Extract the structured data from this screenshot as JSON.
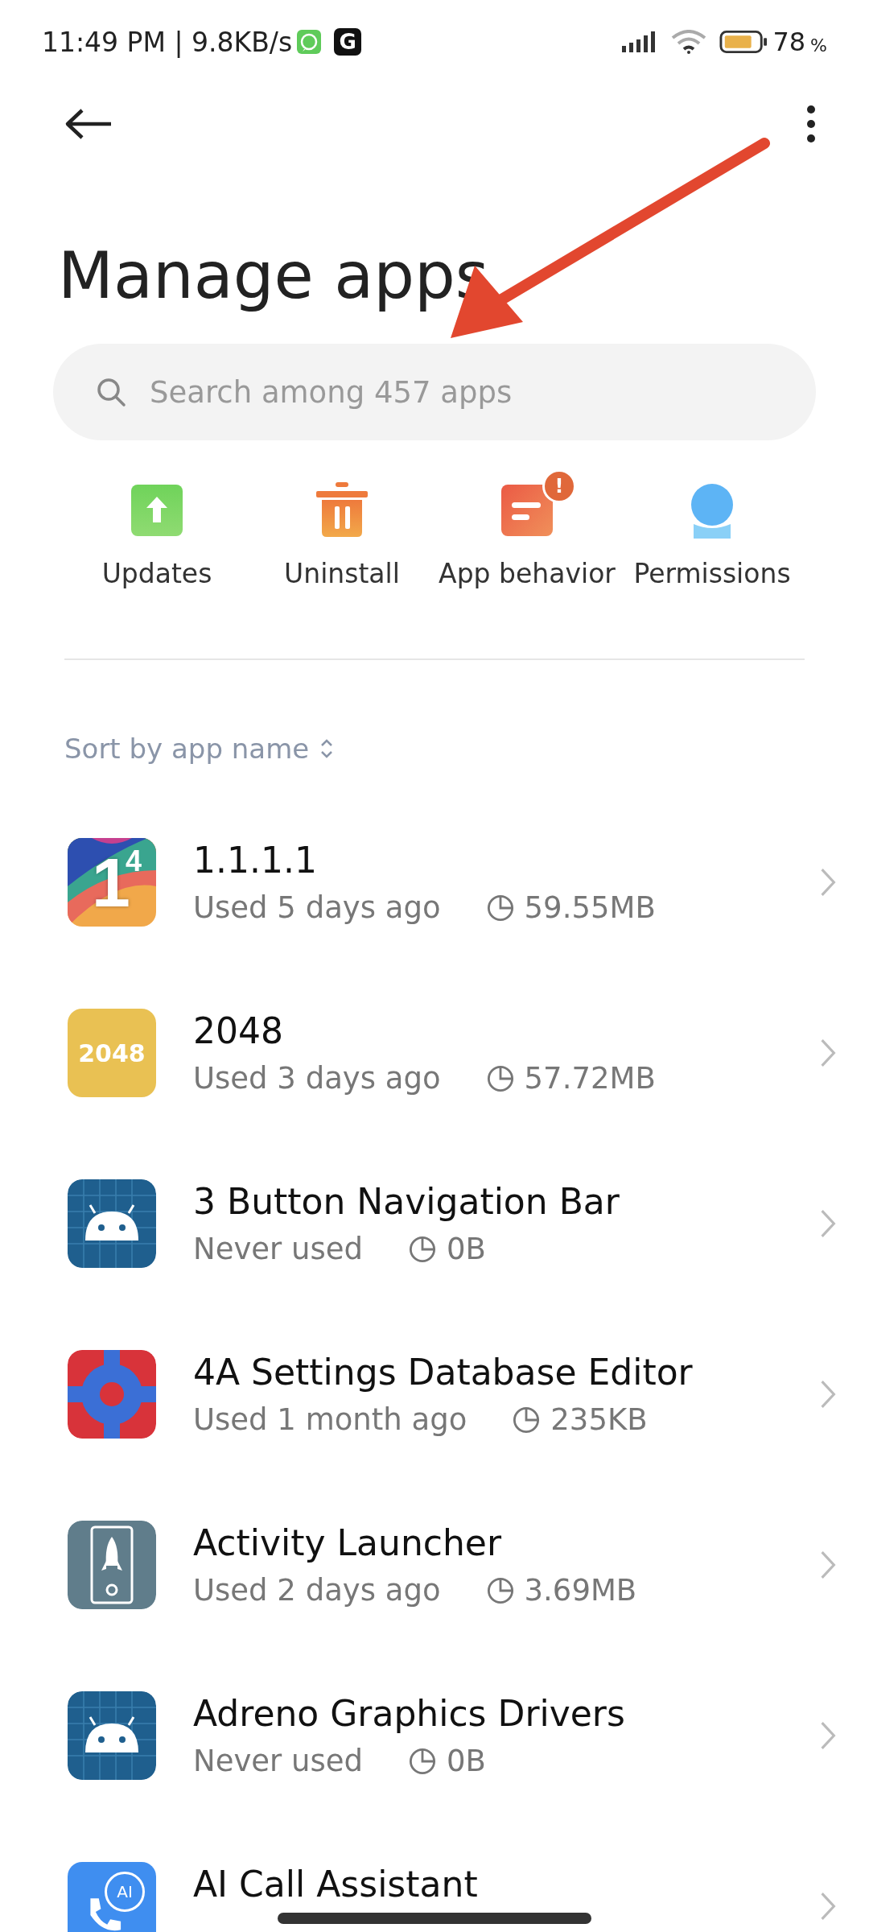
{
  "status_bar": {
    "time": "11:49 PM | 9.8KB/s",
    "notification_icons": [
      {
        "kind": "chat"
      },
      {
        "kind": "letter",
        "text": "G"
      }
    ],
    "battery_percent": "78",
    "battery_unit": "%"
  },
  "title": "Manage apps",
  "search": {
    "placeholder": "Search among 457 apps"
  },
  "quick_actions": [
    {
      "label": "Updates",
      "kind": "updates"
    },
    {
      "label": "Uninstall",
      "kind": "uninstall"
    },
    {
      "label": "App behavior",
      "kind": "behavior",
      "badge": "!"
    },
    {
      "label": "Permissions",
      "kind": "permissions"
    }
  ],
  "sort": {
    "label": "Sort by app name"
  },
  "apps": [
    {
      "name": "1.1.1.1",
      "usage": "Used 5 days ago",
      "size": "59.55MB",
      "kind": "wave",
      "icon_text": "1",
      "icon_sup": "4"
    },
    {
      "name": "2048",
      "usage": "Used 3 days ago",
      "size": "57.72MB",
      "kind": "tile",
      "icon_text": "2048"
    },
    {
      "name": "3 Button Navigation Bar",
      "usage": "Never used",
      "size": "0B",
      "kind": "android"
    },
    {
      "name": "4A Settings Database Editor",
      "usage": "Used 1 month ago",
      "size": "235KB",
      "kind": "gear"
    },
    {
      "name": "Activity Launcher",
      "usage": "Used 2 days ago",
      "size": "3.69MB",
      "kind": "rocket"
    },
    {
      "name": "Adreno Graphics Drivers",
      "usage": "Never used",
      "size": "0B",
      "kind": "android"
    },
    {
      "name": "AI Call Assistant",
      "kind": "call",
      "icon_text": "AI"
    }
  ],
  "annotation": {
    "kind": "arrow"
  }
}
